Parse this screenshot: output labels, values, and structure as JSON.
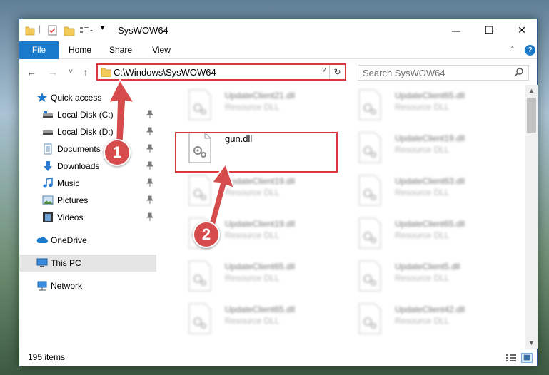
{
  "window": {
    "title": "SysWOW64",
    "controls": {
      "minimize": "—",
      "maximize": "☐",
      "close": "✕"
    }
  },
  "ribbon": {
    "tabs": [
      "File",
      "Home",
      "Share",
      "View"
    ],
    "help": "?",
    "expand": "⌃"
  },
  "nav": {
    "back": "←",
    "forward": "→",
    "recent": "˅",
    "up": "↑",
    "address": "C:\\Windows\\SysWOW64",
    "address_dropdown": "˅",
    "refresh": "↻",
    "search_placeholder": "Search SysWOW64"
  },
  "sidebar": {
    "items": [
      {
        "label": "Quick access",
        "icon": "star-icon",
        "pinned": false
      },
      {
        "label": "Local Disk (C:)",
        "icon": "drive-icon",
        "pinned": true
      },
      {
        "label": "Local Disk (D:)",
        "icon": "drive-icon",
        "pinned": true
      },
      {
        "label": "Documents",
        "icon": "documents-icon",
        "pinned": true
      },
      {
        "label": "Downloads",
        "icon": "downloads-icon",
        "pinned": true
      },
      {
        "label": "Music",
        "icon": "music-icon",
        "pinned": true
      },
      {
        "label": "Pictures",
        "icon": "pictures-icon",
        "pinned": true
      },
      {
        "label": "Videos",
        "icon": "videos-icon",
        "pinned": true
      },
      {
        "label": "OneDrive",
        "icon": "onedrive-icon",
        "pinned": false
      },
      {
        "label": "This PC",
        "icon": "pc-icon",
        "pinned": false,
        "selected": true
      },
      {
        "label": "Network",
        "icon": "network-icon",
        "pinned": false
      }
    ]
  },
  "files": [
    {
      "name": "UpdateClient21.dll",
      "type": "Resource DLL",
      "blurred": true
    },
    {
      "name": "UpdateClient65.dll",
      "type": "Resource DLL",
      "blurred": true
    },
    {
      "name": "gun.dll",
      "type": "",
      "blurred": false
    },
    {
      "name": "UpdateClient19.dll",
      "type": "Resource DLL",
      "blurred": true
    },
    {
      "name": "UpdateClient19.dll",
      "type": "Resource DLL",
      "blurred": true
    },
    {
      "name": "UpdateClient63.dll",
      "type": "Resource DLL",
      "blurred": true
    },
    {
      "name": "UpdateClient19.dll",
      "type": "Resource DLL",
      "blurred": true
    },
    {
      "name": "UpdateClient65.dll",
      "type": "Resource DLL",
      "blurred": true
    },
    {
      "name": "UpdateClient65.dll",
      "type": "Resource DLL",
      "blurred": true
    },
    {
      "name": "UpdateClient5.dll",
      "type": "Resource DLL",
      "blurred": true
    },
    {
      "name": "UpdateClient65.dll",
      "type": "Resource DLL",
      "blurred": true
    },
    {
      "name": "UpdateClient42.dll",
      "type": "Resource DLL",
      "blurred": true
    }
  ],
  "status": {
    "item_count": "195 items"
  },
  "callouts": [
    {
      "label": "1"
    },
    {
      "label": "2"
    }
  ],
  "colors": {
    "accent": "#1979ca",
    "callout": "#d64b4b",
    "highlight": "#d9393d",
    "selected": "#e5e5e5"
  }
}
